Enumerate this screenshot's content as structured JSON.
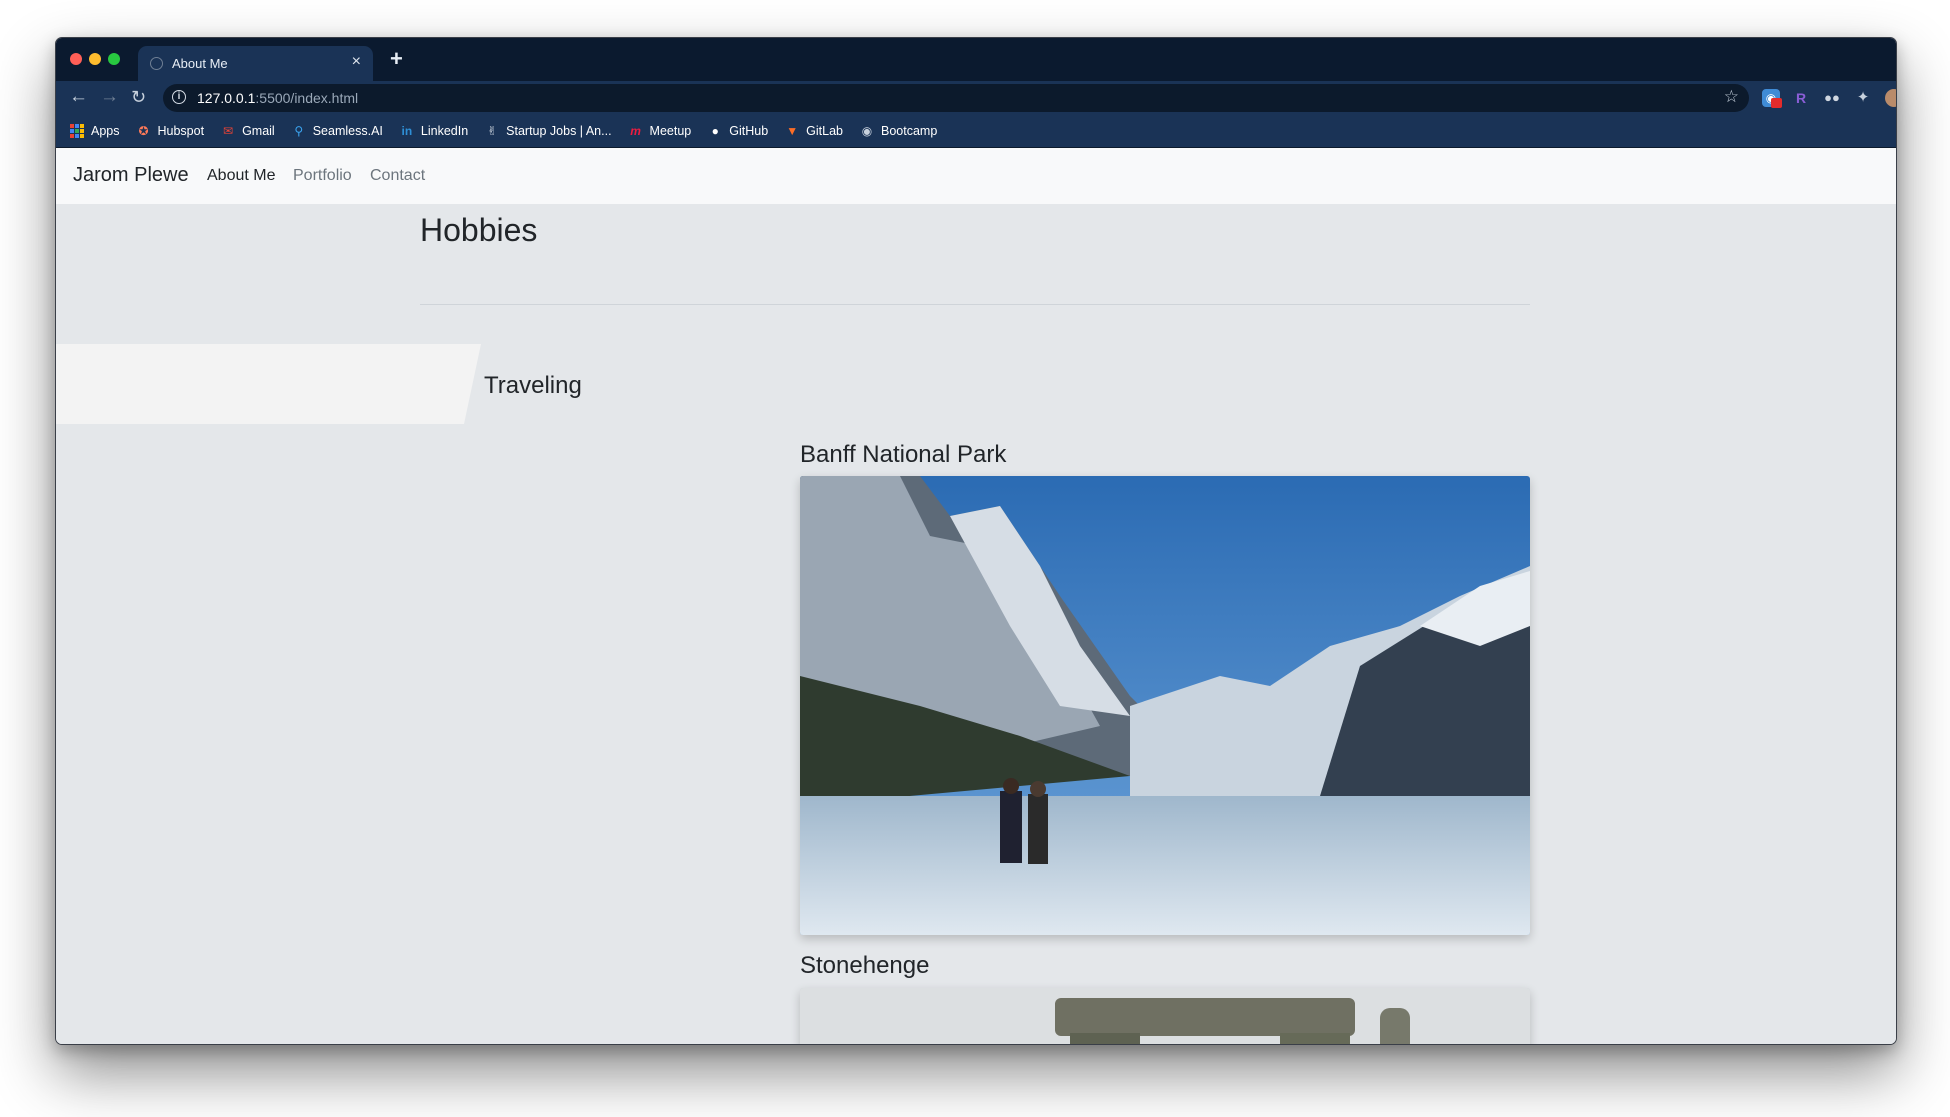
{
  "browser": {
    "tab_title": "About Me",
    "tab_close": "×",
    "new_tab": "+",
    "url_host": "127.0.0.1",
    "url_path": ":5500/index.html",
    "bookmarks": [
      {
        "label": "Apps",
        "icon": "apps-grid-icon"
      },
      {
        "label": "Hubspot",
        "icon": "hubspot-icon"
      },
      {
        "label": "Gmail",
        "icon": "gmail-icon"
      },
      {
        "label": "Seamless.AI",
        "icon": "seamless-icon"
      },
      {
        "label": "LinkedIn",
        "icon": "linkedin-icon"
      },
      {
        "label": "Startup Jobs | An...",
        "icon": "startup-jobs-icon"
      },
      {
        "label": "Meetup",
        "icon": "meetup-icon"
      },
      {
        "label": "GitHub",
        "icon": "github-icon"
      },
      {
        "label": "GitLab",
        "icon": "gitlab-icon"
      },
      {
        "label": "Bootcamp",
        "icon": "globe-icon"
      }
    ]
  },
  "site": {
    "brand": "Jarom Plewe",
    "nav": {
      "about": "About Me",
      "portfolio": "Portfolio",
      "contact": "Contact"
    }
  },
  "content": {
    "section_title": "Hobbies",
    "subheading": "Traveling",
    "places": [
      {
        "title": "Banff National Park"
      },
      {
        "title": "Stonehenge"
      }
    ]
  }
}
